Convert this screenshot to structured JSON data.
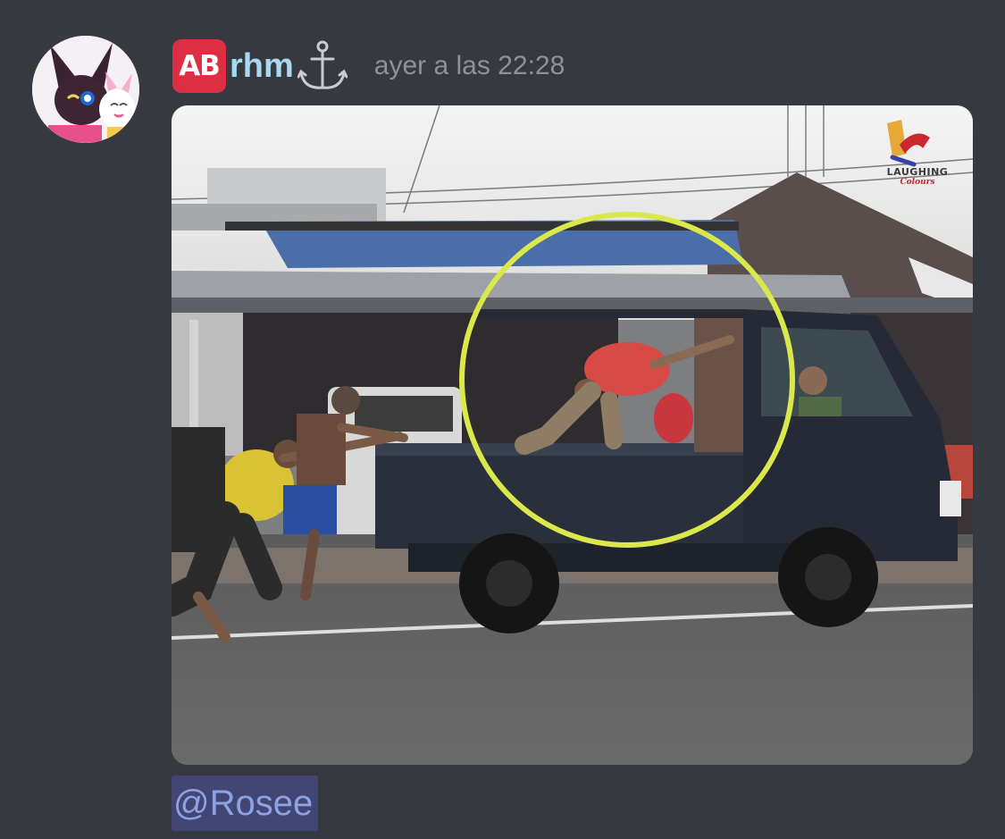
{
  "message": {
    "author": {
      "badge_text": "AB",
      "name": "rhm",
      "name_color": "#a8d9f0",
      "suffix_icon": "anchor-icon",
      "avatar_icon": "avatar-image"
    },
    "timestamp": "ayer a las 22:28",
    "attachment": {
      "type": "image",
      "watermark_line1": "LAUGHING",
      "watermark_line2": "Colours"
    },
    "mention": {
      "text": "@Rosee",
      "bg_color": "#414675",
      "text_color": "#8ea1e1"
    }
  }
}
